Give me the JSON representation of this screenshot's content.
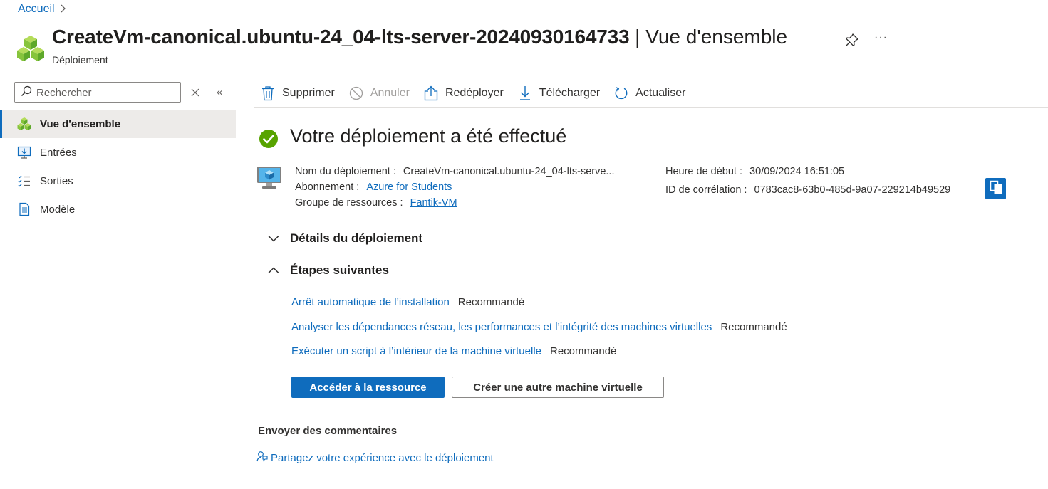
{
  "breadcrumb": {
    "home": "Accueil"
  },
  "header": {
    "title_main": "CreateVm-canonical.ubuntu-24_04-lts-server-20240930164733",
    "title_sep": " | ",
    "title_view": "Vue d'ensemble",
    "subtitle": "Déploiement",
    "more": "···"
  },
  "nav": {
    "search_placeholder": "Rechercher",
    "collapse": "«",
    "items": [
      {
        "label": "Vue d'ensemble",
        "icon": "cubes-icon",
        "active": true
      },
      {
        "label": "Entrées",
        "icon": "monitor-input-icon"
      },
      {
        "label": "Sorties",
        "icon": "checklist-icon"
      },
      {
        "label": "Modèle",
        "icon": "document-icon"
      }
    ]
  },
  "toolbar": {
    "delete": "Supprimer",
    "cancel": "Annuler",
    "redeploy": "Redéployer",
    "download": "Télécharger",
    "refresh": "Actualiser"
  },
  "main": {
    "title": "Votre déploiement a été effectué",
    "deployment_name_label": "Nom du déploiement :",
    "deployment_name_value": "CreateVm-canonical.ubuntu-24_04-lts-serve...",
    "subscription_label": "Abonnement :",
    "subscription_value": "Azure for Students",
    "resource_group_label": "Groupe de ressources :",
    "resource_group_value": "Fantik-VM",
    "start_time_label": "Heure de début :",
    "start_time_value": "30/09/2024 16:51:05",
    "correlation_label": "ID de corrélation :",
    "correlation_value": "0783cac8-63b0-485d-9a07-229214b49529",
    "section_details": "Détails du déploiement",
    "section_next": "Étapes suivantes",
    "next_steps": [
      {
        "label": "Arrêt automatique de l’installation",
        "tag": "Recommandé"
      },
      {
        "label": "Analyser les dépendances réseau, les performances et l’intégrité des machines virtuelles",
        "tag": "Recommandé"
      },
      {
        "label": "Exécuter un script à l’intérieur de la machine virtuelle",
        "tag": "Recommandé"
      }
    ],
    "btn_go_resource": "Accéder à la ressource",
    "btn_create_vm": "Créer une autre machine virtuelle",
    "feedback_title": "Envoyer des commentaires",
    "feedback_link": "Partagez votre expérience avec le déploiement"
  },
  "colors": {
    "accent": "#0f6cbd",
    "success": "#57a300",
    "nav_active_bg": "#edebe9"
  }
}
